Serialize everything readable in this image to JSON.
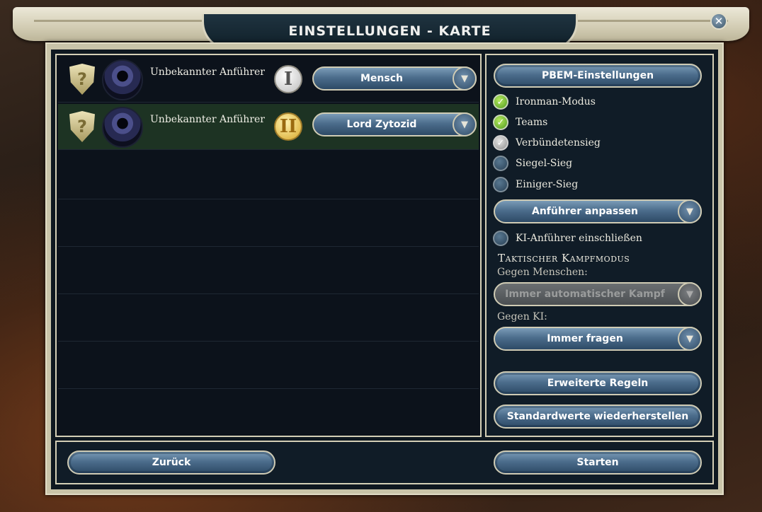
{
  "window": {
    "title": "EINSTELLUNGEN - KARTE",
    "close_label": "✕"
  },
  "players": [
    {
      "leader": "Unbekannter Anführer",
      "team": "I",
      "controller": "Mensch",
      "selected": false
    },
    {
      "leader": "Unbekannter Anführer",
      "team": "II",
      "controller": "Lord Zytozid",
      "selected": true
    }
  ],
  "settings": {
    "pbem_button": "PBEM-Einstellungen",
    "options": [
      {
        "label": "Ironman-Modus",
        "state": "checked"
      },
      {
        "label": "Teams",
        "state": "checked"
      },
      {
        "label": "Verbündetensieg",
        "state": "checked-disabled"
      },
      {
        "label": "Siegel-Sieg",
        "state": "unchecked"
      },
      {
        "label": "Einiger-Sieg",
        "state": "unchecked"
      }
    ],
    "customize_leaders": "Anführer anpassen",
    "include_ai_leaders": {
      "label": "KI-Anführer einschließen",
      "state": "unchecked"
    },
    "tactical_title": "Taktischer Kampfmodus",
    "vs_humans_label": "Gegen Menschen:",
    "vs_humans_value": "Immer automatischer Kampf",
    "vs_ai_label": "Gegen KI:",
    "vs_ai_value": "Immer fragen",
    "advanced_rules": "Erweiterte Regeln",
    "restore_defaults": "Standardwerte wiederherstellen"
  },
  "footer": {
    "back": "Zurück",
    "start": "Starten"
  },
  "icons": {
    "unknown_shield": "?",
    "dropdown_arrow": "▼",
    "check": "✓"
  },
  "colors": {
    "button_blue": "#4c6d8c",
    "selected_row": "#1d3323",
    "frame": "#c9c4a9",
    "check_green": "#4f9a1f"
  }
}
